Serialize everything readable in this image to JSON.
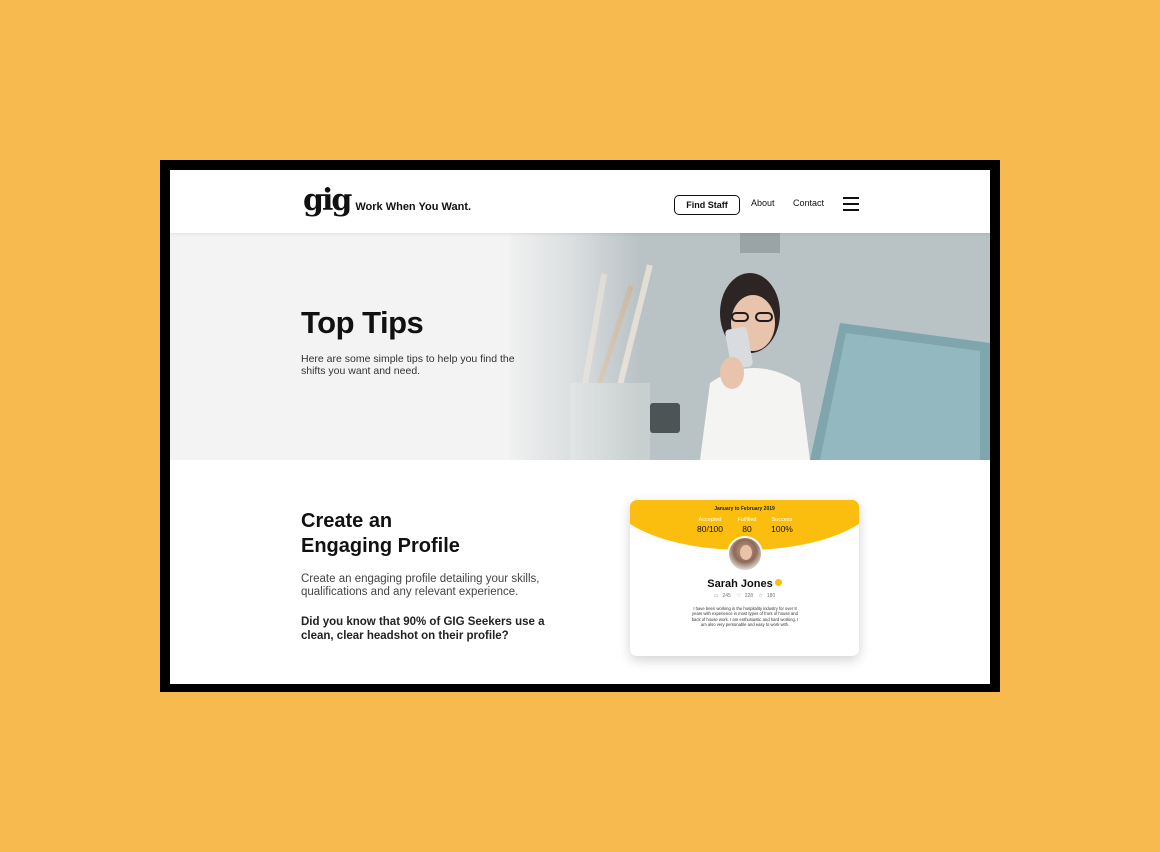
{
  "header": {
    "logo_mark": "gig",
    "tagline": "Work When You Want.",
    "find_staff_label": "Find Staff",
    "about_label": "About",
    "contact_label": "Contact"
  },
  "hero": {
    "title": "Top Tips",
    "subtitle": "Here are some simple tips to help you find the shifts you want and need."
  },
  "profile_section": {
    "title_line1": "Create an",
    "title_line2": "Engaging Profile",
    "body": "Create an engaging profile detailing your skills, qualifications and any relevant experience.",
    "highlight": "Did you know that 90% of GIG Seekers use a clean, clear headshot on their profile?"
  },
  "card": {
    "date_range": "January to February 2019",
    "stats": [
      {
        "label": "Accepted",
        "value": "80/100"
      },
      {
        "label": "Fulfilled",
        "value": "80"
      },
      {
        "label": "Success",
        "value": "100%"
      }
    ],
    "name": "Sarah Jones",
    "meta": [
      "245",
      "228",
      "180"
    ],
    "bio": "I have been working in the hospitality industry for over 8 years with experience in most types of front of house and back of house work. I am enthusiastic and hard working. I am also very personable and easy to work with."
  },
  "colors": {
    "background": "#F7BA4E",
    "card_accent": "#FBBE0F"
  }
}
